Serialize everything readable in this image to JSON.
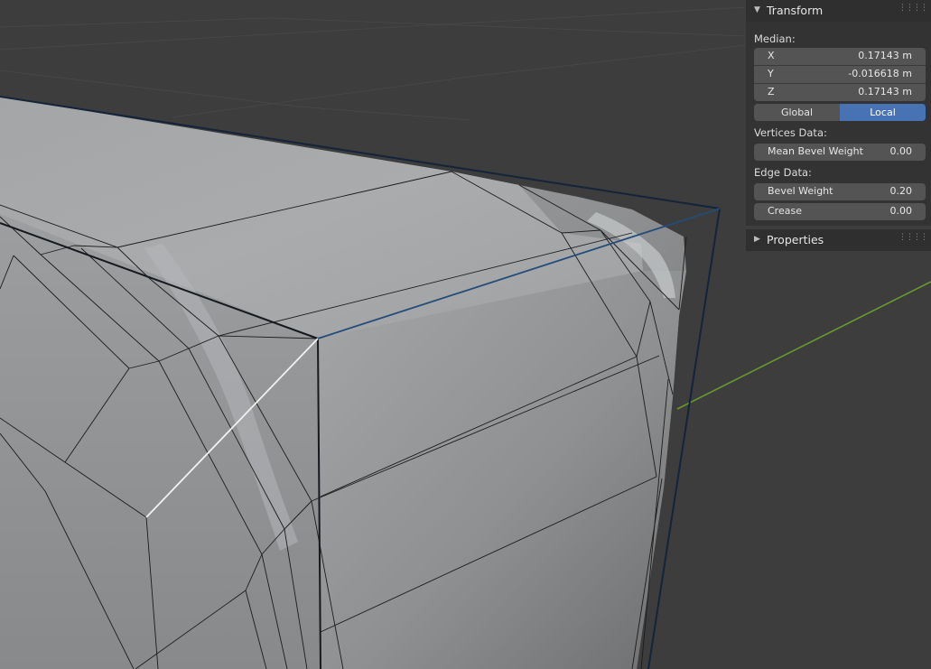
{
  "viewport": {
    "background_color": "#3d3d3d",
    "mesh_color": "#a7a9ab",
    "selected_edge_color": "#1a3a5c",
    "active_edge_color": "#ffffff",
    "y_axis_color": "#6b9a2a"
  },
  "sidebar": {
    "transform": {
      "title": "Transform",
      "expanded": true,
      "median_label": "Median:",
      "x_label": "X",
      "x_value": "0.17143 m",
      "y_label": "Y",
      "y_value": "-0.016618 m",
      "z_label": "Z",
      "z_value": "0.17143 m",
      "global_label": "Global",
      "local_label": "Local",
      "active_space": "Local",
      "vertices_data_label": "Vertices Data:",
      "mean_bevel_weight_label": "Mean Bevel Weight",
      "mean_bevel_weight_value": "0.00",
      "edge_data_label": "Edge Data:",
      "bevel_weight_label": "Bevel Weight",
      "bevel_weight_value": "0.20",
      "crease_label": "Crease",
      "crease_value": "0.00"
    },
    "properties": {
      "title": "Properties",
      "expanded": false
    },
    "accent_color": "#4772b3"
  }
}
